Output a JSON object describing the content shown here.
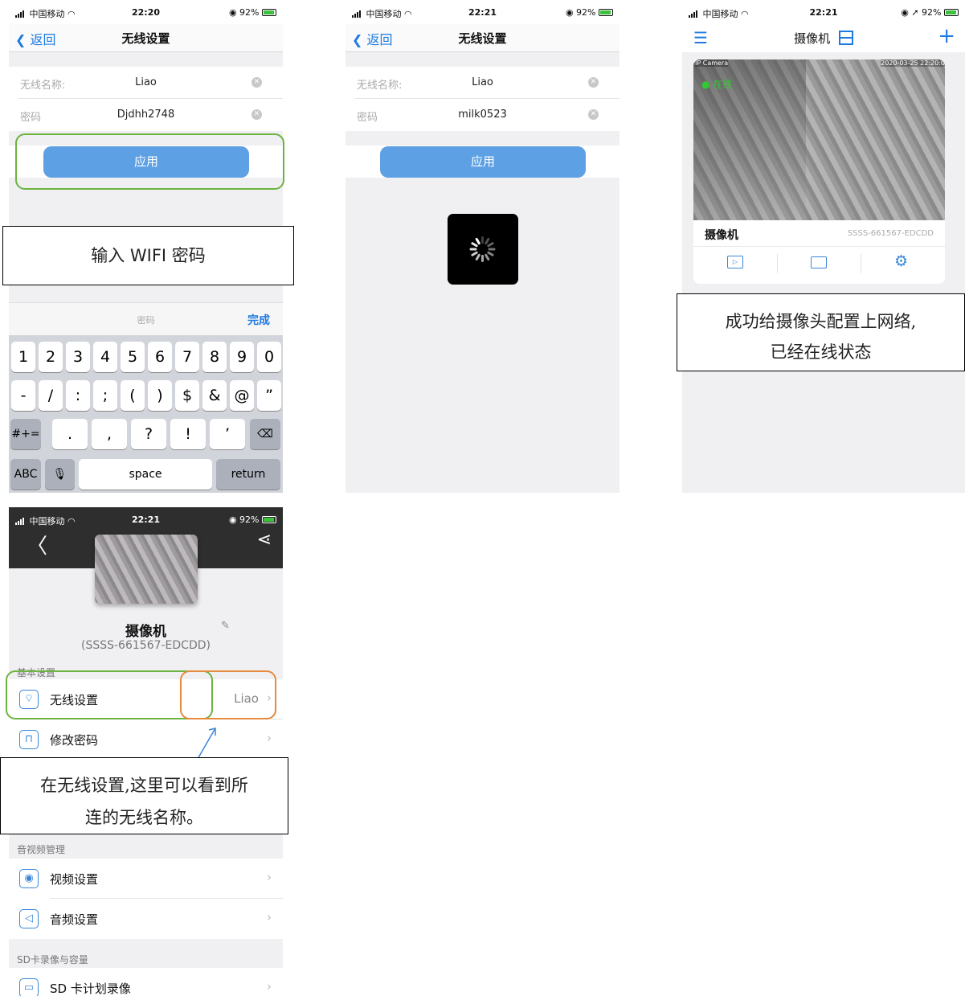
{
  "status_bar": {
    "carrier": "中国移动",
    "time_1": "22:20",
    "time_2": "22:21",
    "battery": "92%"
  },
  "screen1": {
    "back": "返回",
    "title": "无线设置",
    "ssid_label": "无线名称:",
    "ssid_value": "Liao",
    "pwd_label": "密码",
    "pwd_value": "Djdhh2748",
    "apply": "应用",
    "keyboard_placeholder": "密码",
    "keyboard_done": "完成",
    "callout": "输入 WIFI 密码",
    "keys_row1": [
      "1",
      "2",
      "3",
      "4",
      "5",
      "6",
      "7",
      "8",
      "9",
      "0"
    ],
    "keys_row2": [
      "-",
      "/",
      ":",
      ";",
      "(",
      ")",
      "$",
      "&",
      "@",
      "”"
    ],
    "keys_row3": [
      "#+=",
      ".",
      ",",
      "?",
      "!",
      "’"
    ],
    "key_abc": "ABC",
    "key_space": "space",
    "key_return": "return"
  },
  "screen2": {
    "back": "返回",
    "title": "无线设置",
    "ssid_label": "无线名称:",
    "ssid_value": "Liao",
    "pwd_label": "密码",
    "pwd_value": "milk0523",
    "apply": "应用"
  },
  "screen3": {
    "title": "摄像机",
    "overlay_left": "IP Camera",
    "overlay_right": "2020-03-25 22:20:0",
    "online": "在线",
    "camera_name": "摄像机",
    "camera_id": "SSSS-661567-EDCDD",
    "callout_line1": "成功给摄像头配置上网络,",
    "callout_line2": "已经在线状态"
  },
  "screen4": {
    "camera_name": "摄像机",
    "camera_id": "(SSSS-661567-EDCDD)",
    "section_basic": "基本设置",
    "wifi_label": "无线设置",
    "wifi_value": "Liao",
    "change_pwd": "修改密码",
    "callout_line1": "在无线设置,这里可以看到所",
    "callout_line2": "连的无线名称。",
    "section_av": "音视频管理",
    "video_settings": "视频设置",
    "audio_settings": "音频设置",
    "section_sd": "SD卡录像与容量",
    "sd_record": "SD 卡计划录像"
  },
  "colors": {
    "accent": "#1e7ae0",
    "button": "#5da0e3",
    "green_highlight": "#6db33f",
    "orange_highlight": "#e68a3e",
    "online": "#32c832"
  }
}
